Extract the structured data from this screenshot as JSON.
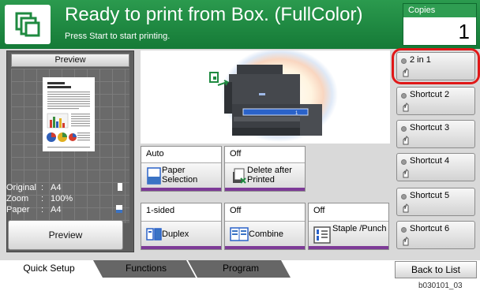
{
  "header": {
    "title": "Ready to print from Box. (FullColor)",
    "subtitle": "Press Start to start printing."
  },
  "copies": {
    "label": "Copies",
    "value": "1"
  },
  "preview_panel": {
    "title": "Preview",
    "info": [
      {
        "key": "Original",
        "value": "A4"
      },
      {
        "key": "Zoom",
        "value": "100%"
      },
      {
        "key": "Paper",
        "value": "A4"
      }
    ],
    "button": "Preview"
  },
  "functions": {
    "paper_selection": {
      "value": "Auto",
      "label": "Paper Selection"
    },
    "delete_after_printed": {
      "value": "Off",
      "label": "Delete after Printed"
    },
    "duplex": {
      "value": "1-sided",
      "label": "Duplex"
    },
    "combine": {
      "value": "Off",
      "label": "Combine"
    },
    "staple_punch": {
      "value": "Off",
      "label": "Staple /Punch"
    }
  },
  "shortcuts": [
    {
      "label": "2 in 1"
    },
    {
      "label": "Shortcut 2"
    },
    {
      "label": "Shortcut 3"
    },
    {
      "label": "Shortcut 4"
    },
    {
      "label": "Shortcut 5"
    },
    {
      "label": "Shortcut 6"
    }
  ],
  "tabs": [
    {
      "label": "Quick Setup"
    },
    {
      "label": "Functions"
    },
    {
      "label": "Program"
    }
  ],
  "back_button": "Back to List",
  "figure_code": "b030101_03",
  "colors": {
    "header_green": "#1d8a41",
    "highlight_red": "#e01818",
    "accent_purple": "#7d3a97"
  }
}
